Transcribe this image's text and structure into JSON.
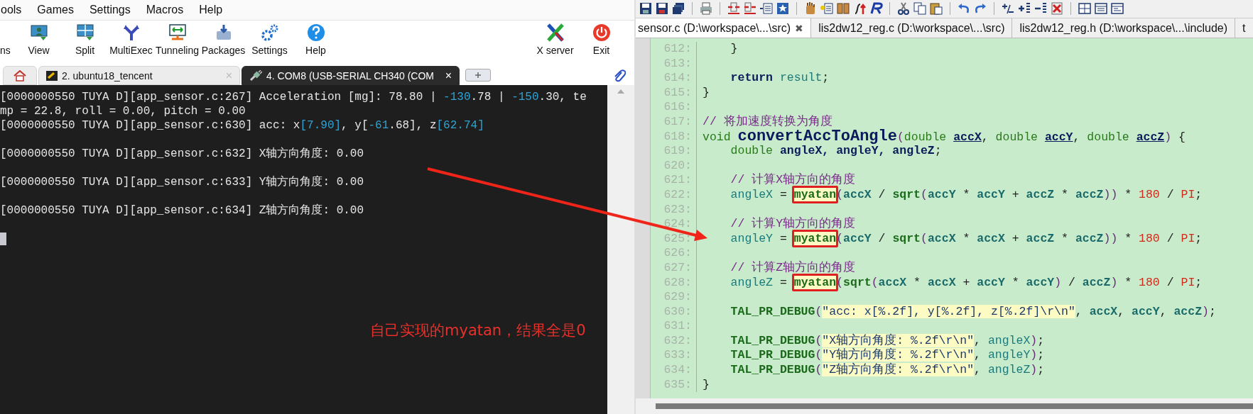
{
  "terminal_app": {
    "menu": [
      "ools",
      "Games",
      "Settings",
      "Macros",
      "Help"
    ],
    "toolbar": [
      {
        "label": "ns"
      },
      {
        "label": "View"
      },
      {
        "label": "Split"
      },
      {
        "label": "MultiExec"
      },
      {
        "label": "Tunneling"
      },
      {
        "label": "Packages"
      },
      {
        "label": "Settings"
      },
      {
        "label": "Help"
      }
    ],
    "toolbar_right": [
      {
        "label": "X server"
      },
      {
        "label": "Exit"
      }
    ],
    "tabs": [
      {
        "kind": "home",
        "selected": false
      },
      {
        "kind": "ssh",
        "label": "2. ubuntu18_tencent",
        "close": "×",
        "selected": false
      },
      {
        "kind": "serial",
        "label": "4. COM8  (USB-SERIAL CH340  (COM",
        "close": "×",
        "selected": true
      }
    ],
    "terminal": {
      "lines": [
        {
          "kind": "text",
          "segments": [
            {
              "text": "[0000000550 TUYA D][app_sensor.c:267] Acceleration [mg]: 78.80 | ",
              "kind": "plain"
            },
            {
              "text": "-130",
              "kind": "num"
            },
            {
              "text": ".78 | ",
              "kind": "plain"
            },
            {
              "text": "-150",
              "kind": "num"
            },
            {
              "text": ".30, te",
              "kind": "plain"
            }
          ]
        },
        {
          "kind": "text",
          "segments": [
            {
              "text": "mp = 22.8, roll = 0.00, pitch = 0.00",
              "kind": "plain"
            }
          ]
        },
        {
          "kind": "text",
          "segments": [
            {
              "text": "[0000000550 TUYA D][app_sensor.c:630] acc: x",
              "kind": "plain"
            },
            {
              "text": "[7.90]",
              "kind": "num"
            },
            {
              "text": ", y[",
              "kind": "plain"
            },
            {
              "text": "-61",
              "kind": "num"
            },
            {
              "text": ".68], z",
              "kind": "plain"
            },
            {
              "text": "[62.74]",
              "kind": "num"
            }
          ]
        },
        {
          "kind": "blank"
        },
        {
          "kind": "text",
          "segments": [
            {
              "text": "[0000000550 TUYA D][app_sensor.c:632] X轴方向角度: 0.00",
              "kind": "plain"
            }
          ]
        },
        {
          "kind": "blank"
        },
        {
          "kind": "text",
          "segments": [
            {
              "text": "[0000000550 TUYA D][app_sensor.c:633] Y轴方向角度: 0.00",
              "kind": "plain"
            }
          ]
        },
        {
          "kind": "blank"
        },
        {
          "kind": "text",
          "segments": [
            {
              "text": "[0000000550 TUYA D][app_sensor.c:634] Z轴方向角度: 0.00",
              "kind": "plain"
            }
          ]
        },
        {
          "kind": "blank"
        },
        {
          "kind": "cursor"
        }
      ]
    }
  },
  "editor": {
    "tabs": [
      {
        "label": "sensor.c (D:\\workspace\\...\\src)",
        "close": "✖",
        "selected": true
      },
      {
        "label": "lis2dw12_reg.c (D:\\workspace\\...\\src)",
        "selected": false
      },
      {
        "label": "lis2dw12_reg.h (D:\\workspace\\...\\include)",
        "selected": false
      },
      {
        "label": "t",
        "selected": false
      }
    ],
    "lines": [
      {
        "number": "612:",
        "tokens": [
          {
            "text": "    }",
            "kind": "plain"
          }
        ]
      },
      {
        "number": "613:"
      },
      {
        "number": "614:",
        "tokens": [
          {
            "text": "    return ",
            "kind": "keyword"
          },
          {
            "text": "result",
            "kind": "ident"
          },
          {
            "text": ";",
            "kind": "plain"
          }
        ]
      },
      {
        "number": "615:",
        "tokens": [
          {
            "text": "}",
            "kind": "plain"
          }
        ]
      },
      {
        "number": "616:"
      },
      {
        "number": "617:",
        "tokens": [
          {
            "text": "// 将加速度转换为角度",
            "kind": "comment"
          }
        ]
      },
      {
        "number": "618:",
        "tokens": [
          {
            "text": "void ",
            "kind": "type"
          },
          {
            "text": "convertAccToAngle",
            "kind": "function"
          },
          {
            "text": "(",
            "kind": "paren"
          },
          {
            "text": "double ",
            "kind": "type"
          },
          {
            "text": "accX",
            "kind": "param"
          },
          {
            "text": ", ",
            "kind": "plain"
          },
          {
            "text": "double ",
            "kind": "type"
          },
          {
            "text": "accY",
            "kind": "param"
          },
          {
            "text": ", ",
            "kind": "plain"
          },
          {
            "text": "double ",
            "kind": "type"
          },
          {
            "text": "accZ",
            "kind": "param"
          },
          {
            "text": ")",
            "kind": "paren"
          },
          {
            "text": " {",
            "kind": "plain"
          }
        ]
      },
      {
        "number": "619:",
        "tokens": [
          {
            "text": "    double ",
            "kind": "type"
          },
          {
            "text": "angleX, angleY, angleZ",
            "kind": "var"
          },
          {
            "text": ";",
            "kind": "plain"
          }
        ]
      },
      {
        "number": "620:"
      },
      {
        "number": "621:",
        "tokens": [
          {
            "text": "    // 计算X轴方向的角度",
            "kind": "comment"
          }
        ]
      },
      {
        "number": "622:",
        "tokens": [
          {
            "text": "    angleX",
            "kind": "ident"
          },
          {
            "text": " = ",
            "kind": "plain"
          },
          {
            "text": "myatan",
            "kind": "boxed"
          },
          {
            "text": "(",
            "kind": "paren"
          },
          {
            "text": "accX",
            "kind": "arg"
          },
          {
            "text": " / ",
            "kind": "plain"
          },
          {
            "text": "sqrt",
            "kind": "macro"
          },
          {
            "text": "(",
            "kind": "paren"
          },
          {
            "text": "accY",
            "kind": "arg"
          },
          {
            "text": " * ",
            "kind": "plain"
          },
          {
            "text": "accY",
            "kind": "arg"
          },
          {
            "text": " + ",
            "kind": "plain"
          },
          {
            "text": "accZ",
            "kind": "arg"
          },
          {
            "text": " * ",
            "kind": "plain"
          },
          {
            "text": "accZ",
            "kind": "arg"
          },
          {
            "text": "))",
            "kind": "paren"
          },
          {
            "text": " * ",
            "kind": "plain"
          },
          {
            "text": "180",
            "kind": "number"
          },
          {
            "text": " / ",
            "kind": "plain"
          },
          {
            "text": "PI",
            "kind": "number"
          },
          {
            "text": ";",
            "kind": "plain"
          }
        ]
      },
      {
        "number": "623:"
      },
      {
        "number": "624:",
        "tokens": [
          {
            "text": "    // 计算Y轴方向的角度",
            "kind": "comment"
          }
        ]
      },
      {
        "number": "625:",
        "tokens": [
          {
            "text": "    angleY",
            "kind": "ident"
          },
          {
            "text": " = ",
            "kind": "plain"
          },
          {
            "text": "myatan",
            "kind": "boxed"
          },
          {
            "text": "(",
            "kind": "paren"
          },
          {
            "text": "accY",
            "kind": "arg"
          },
          {
            "text": " / ",
            "kind": "plain"
          },
          {
            "text": "sqrt",
            "kind": "macro"
          },
          {
            "text": "(",
            "kind": "paren"
          },
          {
            "text": "accX",
            "kind": "arg"
          },
          {
            "text": " * ",
            "kind": "plain"
          },
          {
            "text": "accX",
            "kind": "arg"
          },
          {
            "text": " + ",
            "kind": "plain"
          },
          {
            "text": "accZ",
            "kind": "arg"
          },
          {
            "text": " * ",
            "kind": "plain"
          },
          {
            "text": "accZ",
            "kind": "arg"
          },
          {
            "text": "))",
            "kind": "paren"
          },
          {
            "text": " * ",
            "kind": "plain"
          },
          {
            "text": "180",
            "kind": "number"
          },
          {
            "text": " / ",
            "kind": "plain"
          },
          {
            "text": "PI",
            "kind": "number"
          },
          {
            "text": ";",
            "kind": "plain"
          }
        ]
      },
      {
        "number": "626:"
      },
      {
        "number": "627:",
        "tokens": [
          {
            "text": "    // 计算Z轴方向的角度",
            "kind": "comment"
          }
        ]
      },
      {
        "number": "628:",
        "tokens": [
          {
            "text": "    angleZ",
            "kind": "ident"
          },
          {
            "text": " = ",
            "kind": "plain"
          },
          {
            "text": "myatan",
            "kind": "boxed"
          },
          {
            "text": "(",
            "kind": "paren"
          },
          {
            "text": "sqrt",
            "kind": "macro"
          },
          {
            "text": "(",
            "kind": "paren"
          },
          {
            "text": "accX",
            "kind": "arg"
          },
          {
            "text": " * ",
            "kind": "plain"
          },
          {
            "text": "accX",
            "kind": "arg"
          },
          {
            "text": " + ",
            "kind": "plain"
          },
          {
            "text": "accY",
            "kind": "arg"
          },
          {
            "text": " * ",
            "kind": "plain"
          },
          {
            "text": "accY",
            "kind": "arg"
          },
          {
            "text": ")",
            "kind": "paren"
          },
          {
            "text": " / ",
            "kind": "plain"
          },
          {
            "text": "accZ",
            "kind": "arg"
          },
          {
            "text": ")",
            "kind": "paren"
          },
          {
            "text": " * ",
            "kind": "plain"
          },
          {
            "text": "180",
            "kind": "number"
          },
          {
            "text": " / ",
            "kind": "plain"
          },
          {
            "text": "PI",
            "kind": "number"
          },
          {
            "text": ";",
            "kind": "plain"
          }
        ]
      },
      {
        "number": "629:"
      },
      {
        "number": "630:",
        "tokens": [
          {
            "text": "    TAL_PR_DEBUG",
            "kind": "macro"
          },
          {
            "text": "(",
            "kind": "paren"
          },
          {
            "text": "\"acc: x[%.2f], y[%.2f], z[%.2f]\\r\\n\"",
            "kind": "string"
          },
          {
            "text": ", ",
            "kind": "plain"
          },
          {
            "text": "accX",
            "kind": "arg"
          },
          {
            "text": ", ",
            "kind": "plain"
          },
          {
            "text": "accY",
            "kind": "arg"
          },
          {
            "text": ", ",
            "kind": "plain"
          },
          {
            "text": "accZ",
            "kind": "arg"
          },
          {
            "text": ")",
            "kind": "paren"
          },
          {
            "text": ";",
            "kind": "plain"
          }
        ]
      },
      {
        "number": "631:"
      },
      {
        "number": "632:",
        "tokens": [
          {
            "text": "    TAL_PR_DEBUG",
            "kind": "macro"
          },
          {
            "text": "(",
            "kind": "paren"
          },
          {
            "text": "\"X轴方向角度: %.2f\\r\\n\"",
            "kind": "string"
          },
          {
            "text": ", ",
            "kind": "plain"
          },
          {
            "text": "angleX",
            "kind": "ident"
          },
          {
            "text": ")",
            "kind": "paren"
          },
          {
            "text": ";",
            "kind": "plain"
          }
        ]
      },
      {
        "number": "633:",
        "tokens": [
          {
            "text": "    TAL_PR_DEBUG",
            "kind": "macro"
          },
          {
            "text": "(",
            "kind": "paren"
          },
          {
            "text": "\"Y轴方向角度: %.2f\\r\\n\"",
            "kind": "string"
          },
          {
            "text": ", ",
            "kind": "plain"
          },
          {
            "text": "angleY",
            "kind": "ident"
          },
          {
            "text": ")",
            "kind": "paren"
          },
          {
            "text": ";",
            "kind": "plain"
          }
        ]
      },
      {
        "number": "634:",
        "tokens": [
          {
            "text": "    TAL_PR_DEBUG",
            "kind": "macro"
          },
          {
            "text": "(",
            "kind": "paren"
          },
          {
            "text": "\"Z轴方向角度: %.2f\\r\\n\"",
            "kind": "string"
          },
          {
            "text": ", ",
            "kind": "plain"
          },
          {
            "text": "angleZ",
            "kind": "ident"
          },
          {
            "text": ")",
            "kind": "paren"
          },
          {
            "text": ";",
            "kind": "plain"
          }
        ]
      },
      {
        "number": "635:",
        "tokens": [
          {
            "text": "}",
            "kind": "plain"
          }
        ]
      }
    ]
  },
  "annotation": {
    "text": "自己实现的myatan，结果全是0"
  }
}
